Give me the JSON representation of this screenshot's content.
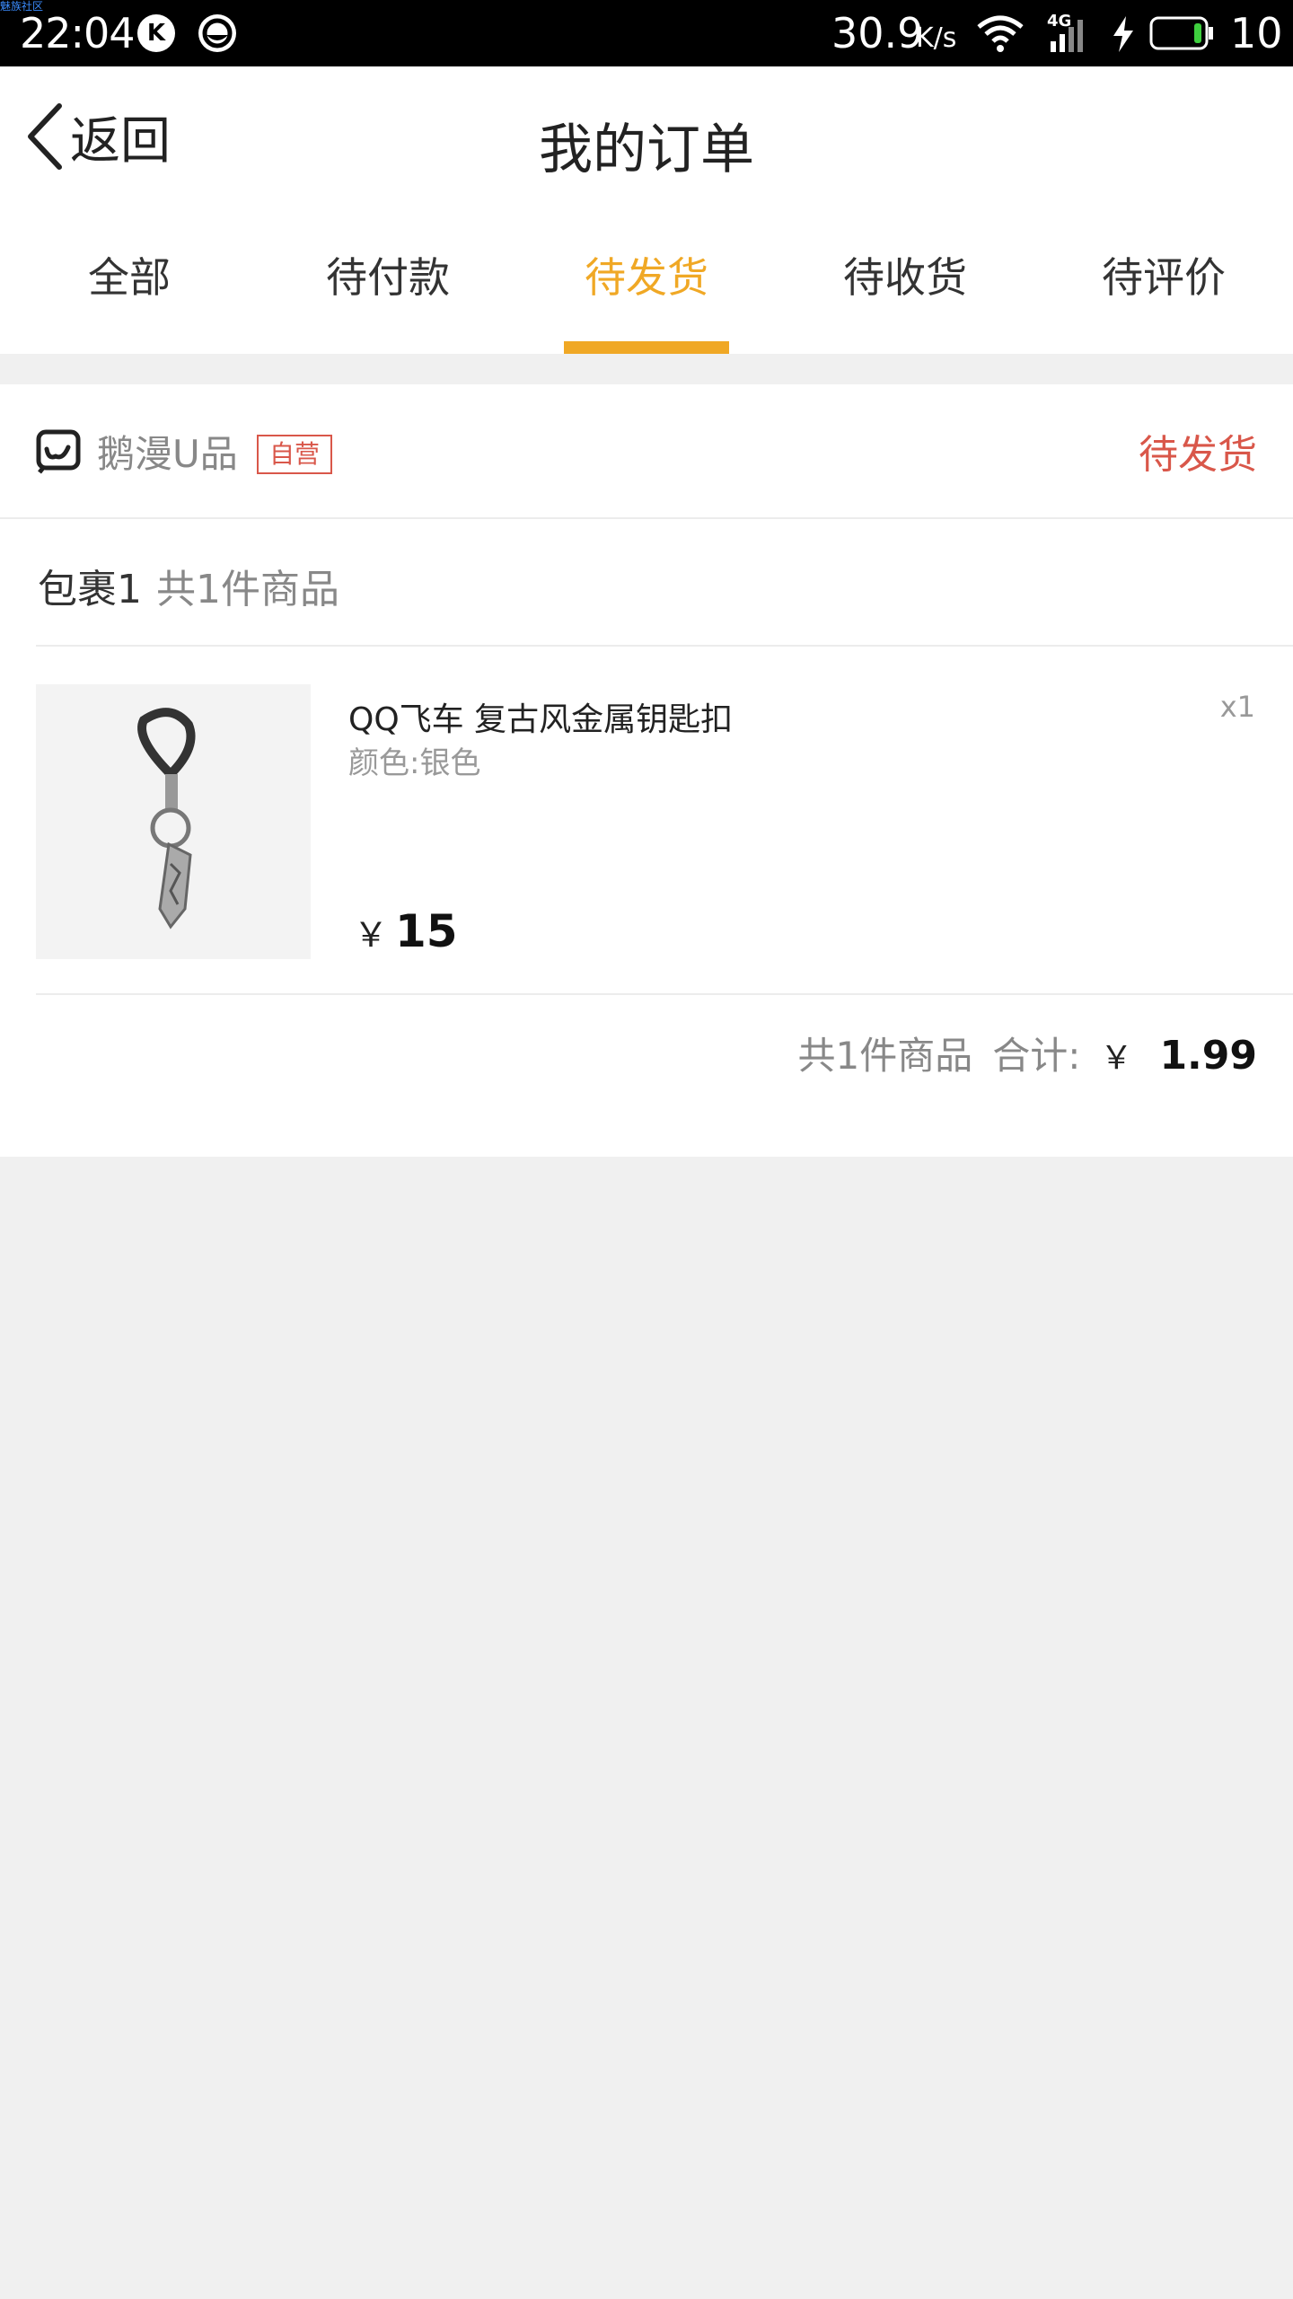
{
  "status_bar": {
    "corner_text": "魅族社区",
    "time": "22:04",
    "app_icon_1": "K",
    "network_speed": "30.9",
    "network_unit": "K/s",
    "network_type": "4G",
    "battery": "10"
  },
  "header": {
    "back_label": "返回",
    "title": "我的订单"
  },
  "tabs": [
    {
      "label": "全部"
    },
    {
      "label": "待付款"
    },
    {
      "label": "待发货",
      "active": true
    },
    {
      "label": "待收货"
    },
    {
      "label": "待评价"
    }
  ],
  "order": {
    "shop_name": "鹅漫U品",
    "shop_tag": "自营",
    "status": "待发货",
    "package_title": "包裹1",
    "package_count": "共1件商品",
    "product": {
      "name": "QQ飞车 复古风金属钥匙扣",
      "spec": "颜色:银色",
      "quantity": "x1",
      "currency": "￥",
      "price": "15"
    },
    "summary": {
      "count": "共1件商品",
      "label": "合计:",
      "currency": "￥",
      "amount": "1.99"
    }
  },
  "colors": {
    "accent": "#f0a825",
    "status": "#d9574a"
  }
}
